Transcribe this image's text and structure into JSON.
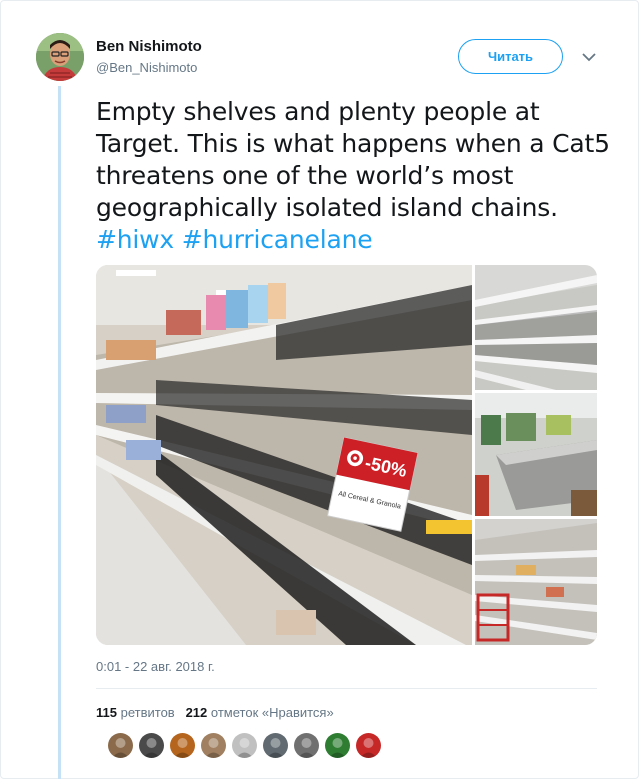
{
  "author": {
    "name": "Ben Nishimoto",
    "handle": "@Ben_Nishimoto"
  },
  "follow_label": "Читать",
  "tweet": {
    "text": "Empty shelves and plenty people at Target. This is what happens when a Cat5 threatens one of the world’s most geographically isolated island chains.",
    "hashtags": [
      "#hiwx",
      "#hurricanelane"
    ]
  },
  "media": {
    "sign_text": "-50%",
    "sign_subtext": "All Cereal & Granola"
  },
  "timestamp": "0:01 - 22 авг. 2018 г.",
  "stats": {
    "retweets_count": "115",
    "retweets_label": "ретвитов",
    "likes_count": "212",
    "likes_label": "отметок «Нравится»"
  },
  "likers": [
    {
      "color": "#8a6a4a"
    },
    {
      "color": "#4a4a4a"
    },
    {
      "color": "#b5651d"
    },
    {
      "color": "#a08060"
    },
    {
      "color": "#c0c0c0"
    },
    {
      "color": "#606a70"
    },
    {
      "color": "#707070"
    },
    {
      "color": "#2e7d32"
    },
    {
      "color": "#c62828"
    }
  ],
  "colors": {
    "accent": "#1da1f2",
    "thread_line": "#c4e1f5",
    "muted": "#657786"
  }
}
